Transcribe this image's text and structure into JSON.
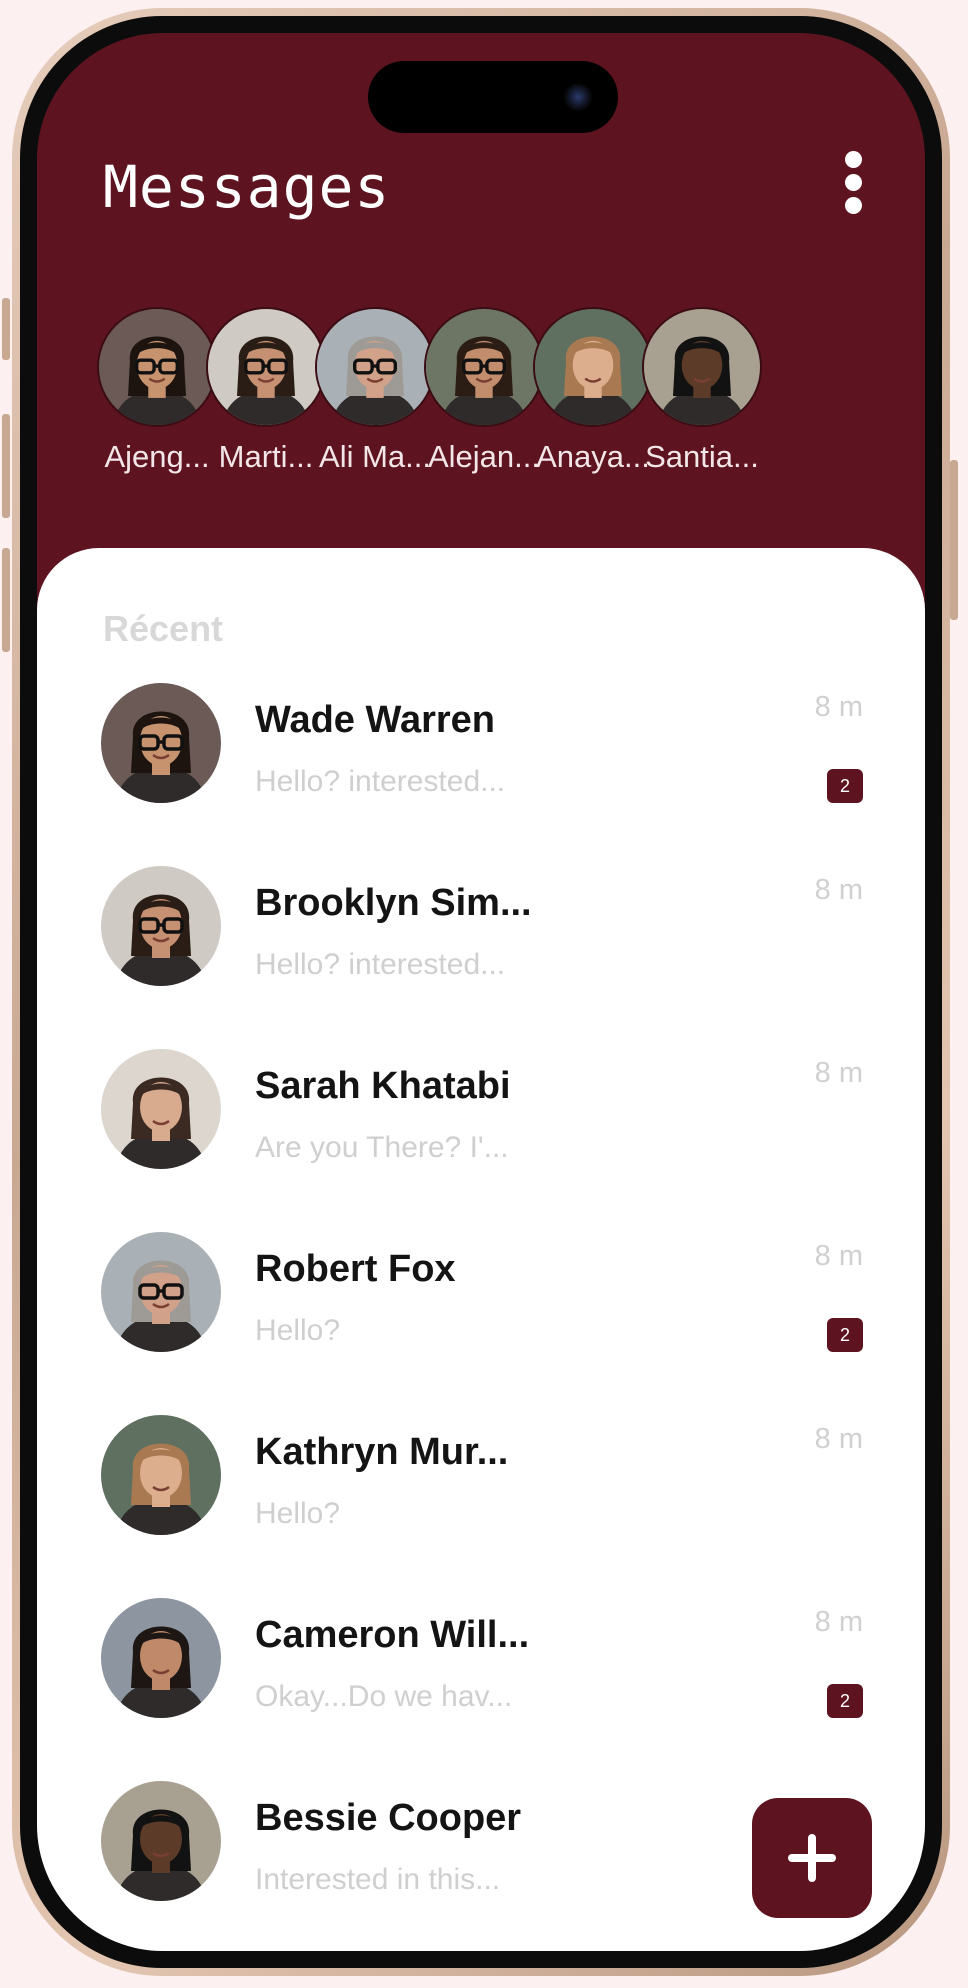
{
  "header": {
    "title": "Messages",
    "menu_icon": "more-vertical-icon"
  },
  "stories": [
    {
      "name": "Ajeng...",
      "skin": "#c7936f",
      "hair": "#1e140f",
      "bg": "#6b5a55",
      "glasses": true
    },
    {
      "name": "Marti...",
      "skin": "#c69072",
      "hair": "#2a1d16",
      "bg": "#cfcac4",
      "glasses": true
    },
    {
      "name": "Ali Ma...",
      "skin": "#d2a18a",
      "hair": "#9e9a96",
      "bg": "#a9b1b6",
      "glasses": true
    },
    {
      "name": "Alejan...",
      "skin": "#c28d6d",
      "hair": "#2b1d14",
      "bg": "#6d7665",
      "glasses": true
    },
    {
      "name": "Anaya...",
      "skin": "#dcae8d",
      "hair": "#a97a52",
      "bg": "#5f6f60",
      "glasses": false
    },
    {
      "name": "Santia...",
      "skin": "#5c3b28",
      "hair": "#121212",
      "bg": "#a8a090",
      "glasses": false
    }
  ],
  "section_title": "Récent",
  "chats": [
    {
      "name": "Wade Warren",
      "preview": "Hello? interested...",
      "time": "8 m",
      "badge": "2",
      "skin": "#c7936f",
      "hair": "#1e140f",
      "bg": "#6b5a55",
      "glasses": true
    },
    {
      "name": "Brooklyn Sim...",
      "preview": "Hello? interested...",
      "time": "8 m",
      "badge": "",
      "skin": "#c69072",
      "hair": "#2a1d16",
      "bg": "#cfcac4",
      "glasses": true
    },
    {
      "name": "Sarah Khatabi",
      "preview": "Are you There? I'...",
      "time": "8 m",
      "badge": "",
      "skin": "#d8ab8e",
      "hair": "#3b2a22",
      "bg": "#dcd6ce",
      "glasses": false
    },
    {
      "name": "Robert Fox",
      "preview": "Hello?",
      "time": "8 m",
      "badge": "2",
      "skin": "#d2a18a",
      "hair": "#9e9a96",
      "bg": "#a9b1b6",
      "glasses": true
    },
    {
      "name": "Kathryn Mur...",
      "preview": "Hello?",
      "time": "8 m",
      "badge": "",
      "skin": "#dcae8d",
      "hair": "#a97a52",
      "bg": "#5f6f60",
      "glasses": false
    },
    {
      "name": "Cameron Will...",
      "preview": "Okay...Do we hav...",
      "time": "8 m",
      "badge": "2",
      "skin": "#c08a6a",
      "hair": "#1d1613",
      "bg": "#8c95a0",
      "glasses": false
    },
    {
      "name": "Bessie Cooper",
      "preview": "Interested in this...",
      "time": "",
      "badge": "",
      "skin": "#5c3b28",
      "hair": "#121212",
      "bg": "#a8a090",
      "glasses": false
    }
  ],
  "fab": {
    "icon": "plus-icon"
  },
  "colors": {
    "primary": "#5d1420",
    "sheet": "#ffffff",
    "muted": "#cfcfcf"
  }
}
